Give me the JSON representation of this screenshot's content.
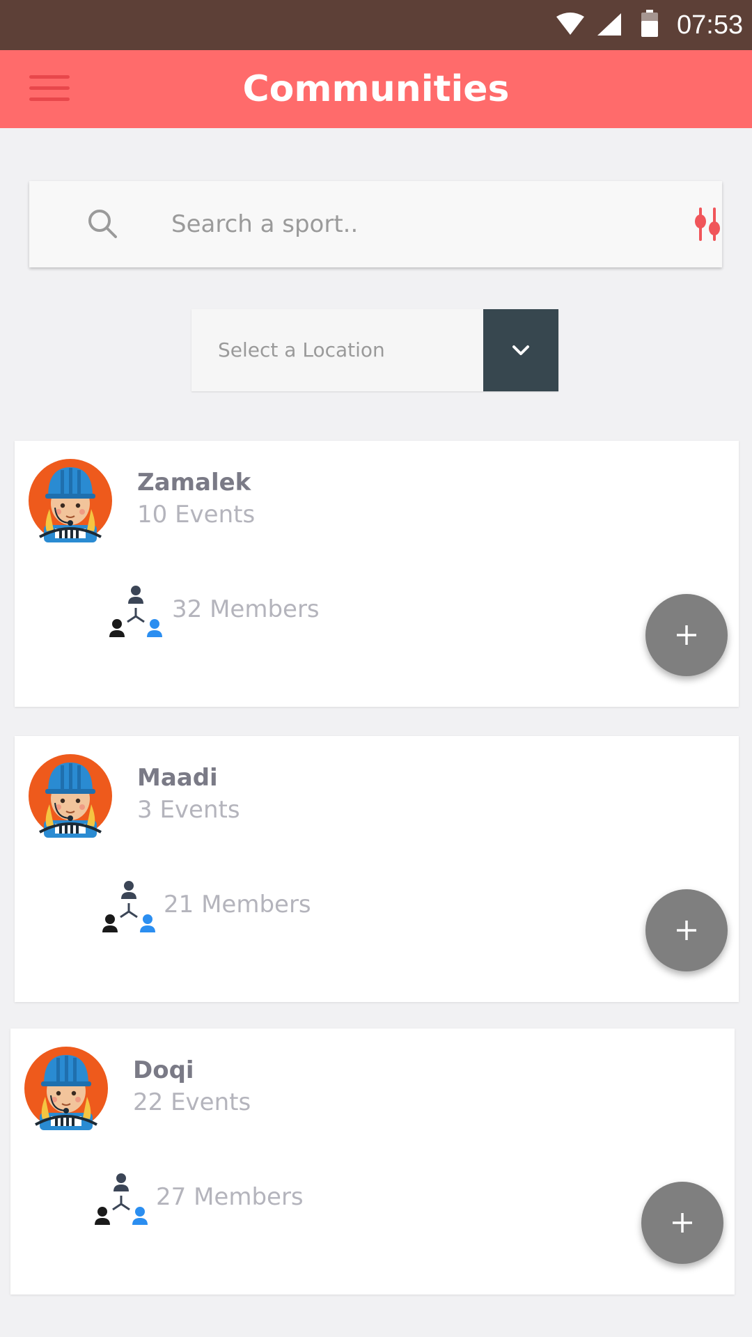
{
  "status_bar": {
    "time": "07:53"
  },
  "app_bar": {
    "title": "Communities"
  },
  "search": {
    "placeholder": "Search a sport..",
    "value": ""
  },
  "location": {
    "label": "Select a Location"
  },
  "communities": [
    {
      "name": "Zamalek",
      "events": "10 Events",
      "members": "32 Members"
    },
    {
      "name": "Maadi",
      "events": "3 Events",
      "members": "21 Members"
    },
    {
      "name": "Doqi",
      "events": "22 Events",
      "members": "27 Members"
    }
  ],
  "icons": {
    "status": [
      "wifi-icon",
      "signal-icon",
      "battery-icon"
    ],
    "app_bar": "menu-icon",
    "search": "search-icon",
    "filter": "filter-sliders-icon",
    "dropdown": "chevron-down-icon",
    "avatar": "cyclist-avatar-icon",
    "members": "members-network-icon",
    "add": "plus-icon"
  },
  "colors": {
    "status_bar": "#5d4037",
    "app_bar": "#ff6b6b",
    "accent": "#f0555a",
    "dropdown_button": "#37474f",
    "fab": "#7f7f7f",
    "avatar_bg": "#ee5a1c",
    "helmet": "#2a8bd2"
  }
}
